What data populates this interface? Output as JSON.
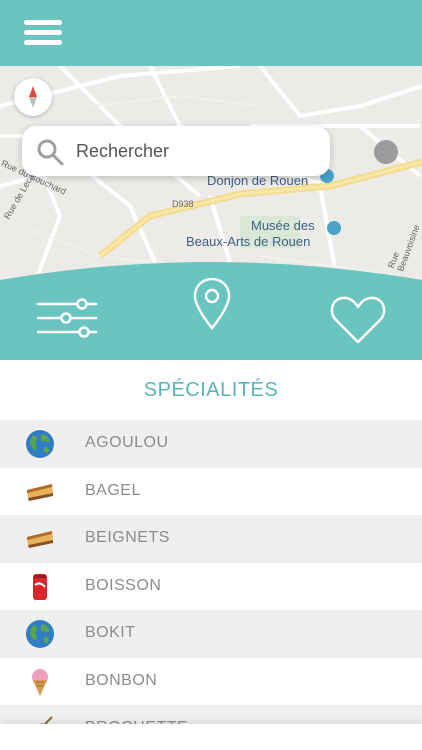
{
  "header": {
    "menu_icon": "hamburger-menu-icon",
    "color": "#6ac4c0"
  },
  "map": {
    "search_placeholder": "Rechercher",
    "places": {
      "donjon": "Donjon de Rouen",
      "musee_line1": "Musée des",
      "musee_line2": "Beaux-Arts de Rouen",
      "road_d938": "D938",
      "rue_lecat": "Rue de Lecat",
      "rue_beauvoisine": "Rue Beauvoisine",
      "rue_bouchard": "Rue du Bouchard"
    }
  },
  "actions": {
    "filters_icon": "sliders-icon",
    "location_icon": "map-pin-icon",
    "favorites_icon": "heart-icon"
  },
  "section": {
    "title": "SPÉCIALITÉS"
  },
  "specialties": [
    {
      "label": "AGOULOU",
      "icon": "globe-icon"
    },
    {
      "label": "BAGEL",
      "icon": "pie-slice-icon"
    },
    {
      "label": "BEIGNETS",
      "icon": "pie-slice-icon"
    },
    {
      "label": "BOISSON",
      "icon": "soda-can-icon"
    },
    {
      "label": "BOKIT",
      "icon": "globe-icon"
    },
    {
      "label": "BONBON",
      "icon": "ice-cream-icon"
    },
    {
      "label": "BROCHETTE",
      "icon": "skewer-icon"
    }
  ],
  "colors": {
    "accent": "#6ac4c0",
    "title_text": "#58b5b7",
    "row_text": "#8c8c8c",
    "row_alt_bg": "#efefef"
  }
}
